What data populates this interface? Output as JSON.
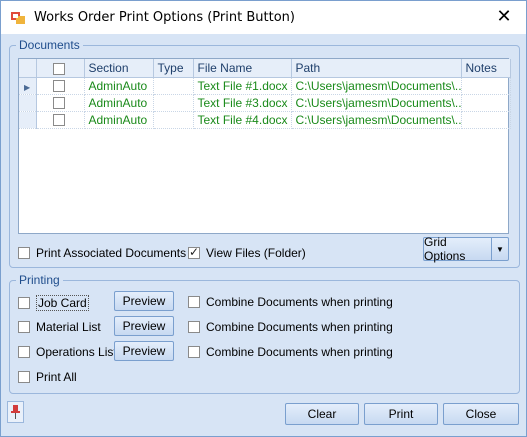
{
  "window": {
    "title": "Works Order Print Options (Print Button)",
    "close_glyph": "✕"
  },
  "documents": {
    "group_title": "Documents",
    "columns": [
      "",
      "Section",
      "Type",
      "File Name",
      "Path",
      "Notes"
    ],
    "rows": [
      {
        "section": "AdminAuto",
        "type": "",
        "file_name": "Text File #1.docx",
        "path": "C:\\Users\\jamesm\\Documents\\...",
        "notes": ""
      },
      {
        "section": "AdminAuto",
        "type": "",
        "file_name": "Text File #3.docx",
        "path": "C:\\Users\\jamesm\\Documents\\...",
        "notes": ""
      },
      {
        "section": "AdminAuto",
        "type": "",
        "file_name": "Text File #4.docx",
        "path": "C:\\Users\\jamesm\\Documents\\...",
        "notes": ""
      }
    ],
    "print_associated_label": "Print Associated Documents",
    "print_associated_checked": false,
    "view_files_label": "View Files (Folder)",
    "view_files_checked": true,
    "grid_options_label": "Grid Options"
  },
  "printing": {
    "group_title": "Printing",
    "items": [
      {
        "label": "Job Card",
        "preview": "Preview",
        "combine": "Combine Documents when printing"
      },
      {
        "label": "Material List",
        "preview": "Preview",
        "combine": "Combine Documents when printing"
      },
      {
        "label": "Operations List",
        "preview": "Preview",
        "combine": "Combine Documents when printing"
      }
    ],
    "print_all_label": "Print All"
  },
  "footer": {
    "clear": "Clear",
    "print": "Print",
    "close": "Close"
  },
  "colors": {
    "accent": "#1f4d8c",
    "row_text": "#1a8a1a",
    "background": "#d7e4f5"
  }
}
